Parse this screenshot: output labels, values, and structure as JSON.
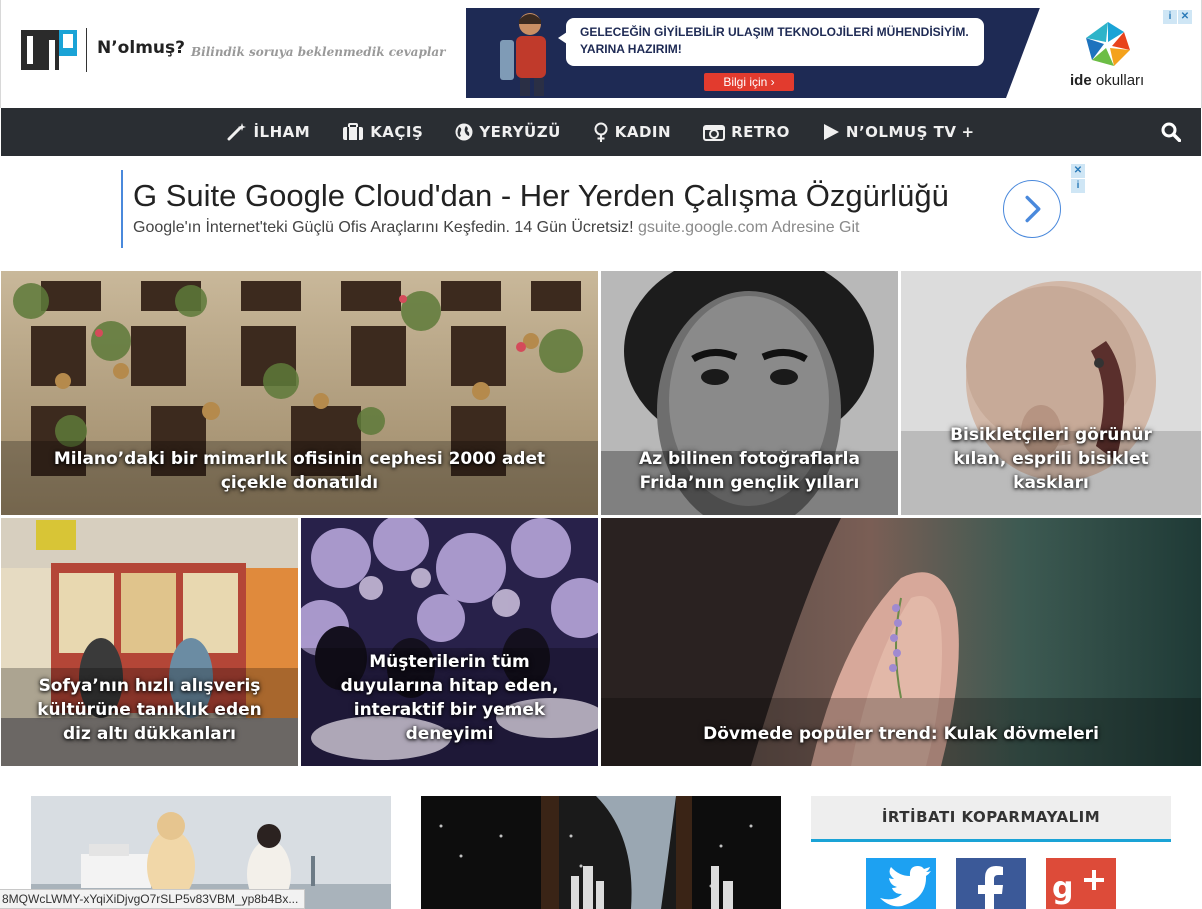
{
  "site": {
    "name": "N’olmuş?",
    "tagline": "Bilindik soruya beklenmedik cevaplar"
  },
  "top_ad": {
    "line1": "GELECEĞİN GİYİLEBİLİR ULAŞIM TEKNOLOJİLERİ MÜHENDİSİYİM.",
    "line2": "YARINA HAZIRIM!",
    "button": "Bilgi için",
    "brand_bold": "ide",
    "brand_rest": "okulları"
  },
  "nav": {
    "items": [
      {
        "label": "İLHAM",
        "icon": "magic-wand-icon"
      },
      {
        "label": "KAÇIŞ",
        "icon": "suitcase-icon"
      },
      {
        "label": "YERYÜZÜ",
        "icon": "globe-icon"
      },
      {
        "label": "KADIN",
        "icon": "female-icon"
      },
      {
        "label": "RETRO",
        "icon": "camera-icon"
      },
      {
        "label": "N’OLMUŞ TV",
        "icon": "play-icon"
      }
    ],
    "tv_plus": "+",
    "search_icon": "search-icon"
  },
  "text_ad": {
    "headline": "G Suite Google Cloud'dan - Her Yerden Çalışma Özgürlüğü",
    "description": "Google'ın İnternet'teki Güçlü Ofis Araçlarını Keşfedin. 14 Gün Ücretsiz!",
    "url": "gsuite.google.com Adresine Git"
  },
  "articles": [
    {
      "caption": "Milano’daki bir mimarlık ofisinin cephesi 2000 adet çiçekle donatıldı"
    },
    {
      "caption": "Az bilinen fotoğraflarla Frida’nın gençlik yılları"
    },
    {
      "caption": "Bisikletçileri görünür kılan, esprili bisiklet kaskları"
    },
    {
      "caption": "Sofya’nın hızlı alışveriş kültürüne tanıklık eden diz altı dükkanları"
    },
    {
      "caption": "Müşterilerin tüm duyularına hitap eden, interaktif bir yemek deneyimi"
    },
    {
      "caption": "Dövmede popüler trend: Kulak dövmeleri"
    }
  ],
  "sidebar": {
    "title": "İRTİBATI KOPARMAYALIM",
    "social": [
      "twitter-icon",
      "facebook-icon",
      "google-plus-icon"
    ]
  },
  "status_bar": {
    "text": "8MQWcLWMY-xYqiXiDjvgO7rSLP5v83VBM_yp8b4Bx..."
  },
  "colors": {
    "nav_bg": "#2a2e33",
    "accent": "#1aa3d6",
    "ad_navy": "#1e2a54",
    "twitter": "#1da1f2",
    "facebook": "#3b5998",
    "google_plus": "#dd4b39"
  }
}
